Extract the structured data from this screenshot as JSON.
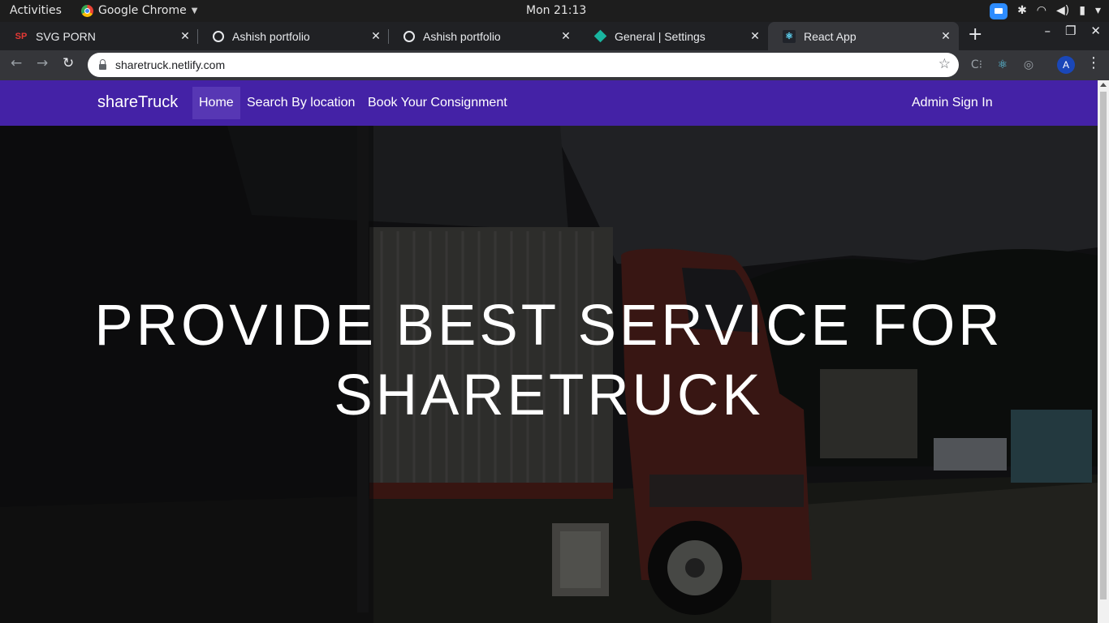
{
  "system_bar": {
    "activities": "Activities",
    "app_name": "Google Chrome",
    "clock": "Mon 21:13"
  },
  "browser": {
    "tabs": [
      {
        "title": "SVG PORN",
        "favicon": "SP",
        "active": false
      },
      {
        "title": "Ashish portfolio",
        "favicon": "globe-icon",
        "active": false
      },
      {
        "title": "Ashish portfolio",
        "favicon": "globe-icon",
        "active": false
      },
      {
        "title": "General | Settings",
        "favicon": "diamond-icon",
        "active": false
      },
      {
        "title": "React App",
        "favicon": "react-icon",
        "active": true
      }
    ],
    "url": "sharetruck.netlify.com",
    "profile_initial": "A"
  },
  "site": {
    "brand": "shareTruck",
    "nav": [
      {
        "label": "Home",
        "active": true
      },
      {
        "label": "Search By location",
        "active": false
      },
      {
        "label": "Book Your Consignment",
        "active": false
      }
    ],
    "admin_link": "Admin Sign In",
    "hero": {
      "headline_line1": "PROVIDE BEST SERVICE FOR",
      "headline_line2": "SHARETRUCK"
    }
  },
  "colors": {
    "navbar": "#4422a6",
    "navbar_active": "#5737b4",
    "hero_text": "#ffffff"
  }
}
